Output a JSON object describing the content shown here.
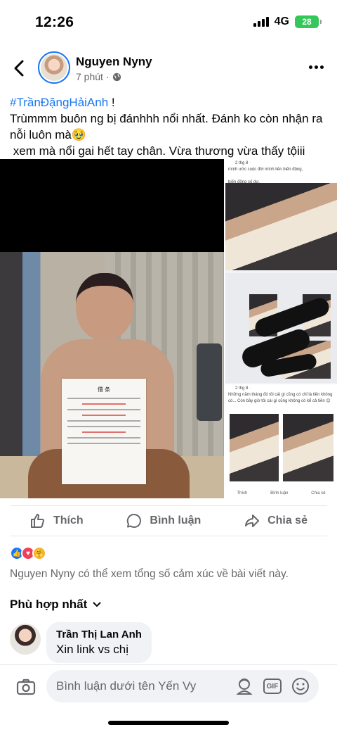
{
  "status": {
    "time": "12:26",
    "network": "4G",
    "battery": "28"
  },
  "post": {
    "author": "Nguyen Nyny",
    "time": "7 phút",
    "hashtag": "#TrầnĐặngHảiAnh",
    "hashtag_suffix": " !",
    "line2": "Trùmmm buôn ng bị đánhhh nổi nhất. Đánh ko còn nhận ra nỗi luôn mà🥹",
    "line3": " xem mà nổi gai hết tay chân. Vừa thương vừa thấy tộiii"
  },
  "media": {
    "paper_title": "借 条",
    "shot1_text": "      2 thg 8 · \nmình ước cuộc đời mình liên biến động,\n\nbiến động số dư.",
    "shot3_text": "      2 thg 8 · \nNhững năm tháng đó tôi cái gì cũng có chỉ là tiền không có... Còn bây giờ tôi cái gì cũng không có kể cả tiền 😊",
    "mini_like": "Thích",
    "mini_comment": "Bình luận",
    "mini_share": "Chia sẻ"
  },
  "actions": {
    "like": "Thích",
    "comment": "Bình luận",
    "share": "Chia sẻ"
  },
  "reaction_note": "Nguyen Nyny có thể xem tổng số cảm xúc về bài viết này.",
  "sort_label": "Phù hợp nhất",
  "comment": {
    "author": "Trần Thị Lan Anh",
    "text": "Xin link vs chị"
  },
  "composer": {
    "placeholder": "Bình luận dưới tên Yến Vy",
    "gif": "GIF"
  },
  "colors": {
    "accent": "#1877f2",
    "muted": "#65676b"
  }
}
